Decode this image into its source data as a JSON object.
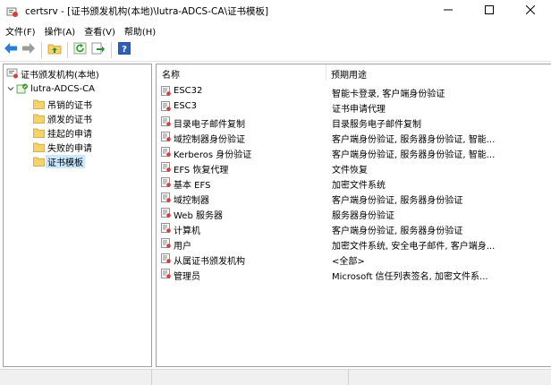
{
  "window": {
    "title": "certsrv - [证书颁发机构(本地)\\lutra-ADCS-CA\\证书模板]"
  },
  "menu": {
    "items": [
      "文件(F)",
      "操作(A)",
      "查看(V)",
      "帮助(H)"
    ]
  },
  "tree": {
    "root": "证书颁发机构(本地)",
    "ca": "lutra-ADCS-CA",
    "children": [
      "吊销的证书",
      "颁发的证书",
      "挂起的申请",
      "失败的申请",
      "证书模板"
    ],
    "selected": "证书模板"
  },
  "list": {
    "columns": [
      "名称",
      "预期用途"
    ],
    "rows": [
      {
        "name": "ESC32",
        "purpose": "智能卡登录, 客户端身份验证"
      },
      {
        "name": "ESC3",
        "purpose": "证书申请代理"
      },
      {
        "name": "目录电子邮件复制",
        "purpose": "目录服务电子邮件复制"
      },
      {
        "name": "域控制器身份验证",
        "purpose": "客户端身份验证, 服务器身份验证, 智能..."
      },
      {
        "name": "Kerberos 身份验证",
        "purpose": "客户端身份验证, 服务器身份验证, 智能..."
      },
      {
        "name": "EFS 恢复代理",
        "purpose": "文件恢复"
      },
      {
        "name": "基本 EFS",
        "purpose": "加密文件系统"
      },
      {
        "name": "域控制器",
        "purpose": "客户端身份验证, 服务器身份验证"
      },
      {
        "name": "Web 服务器",
        "purpose": "服务器身份验证"
      },
      {
        "name": "计算机",
        "purpose": "客户端身份验证, 服务器身份验证"
      },
      {
        "name": "用户",
        "purpose": "加密文件系统, 安全电子邮件, 客户端身..."
      },
      {
        "name": "从属证书颁发机构",
        "purpose": "<全部>"
      },
      {
        "name": "管理员",
        "purpose": "Microsoft 信任列表签名, 加密文件系..."
      }
    ]
  },
  "icons": {
    "toolbar": [
      "back-icon",
      "forward-icon",
      "up-folder-icon",
      "refresh-icon",
      "export-icon",
      "help-icon"
    ],
    "window_controls": [
      "minimize-icon",
      "maximize-icon",
      "close-icon"
    ]
  },
  "colors": {
    "selection": "#cce8ff",
    "folder": "#f6d26a",
    "arrow": "#2a7fd4"
  }
}
